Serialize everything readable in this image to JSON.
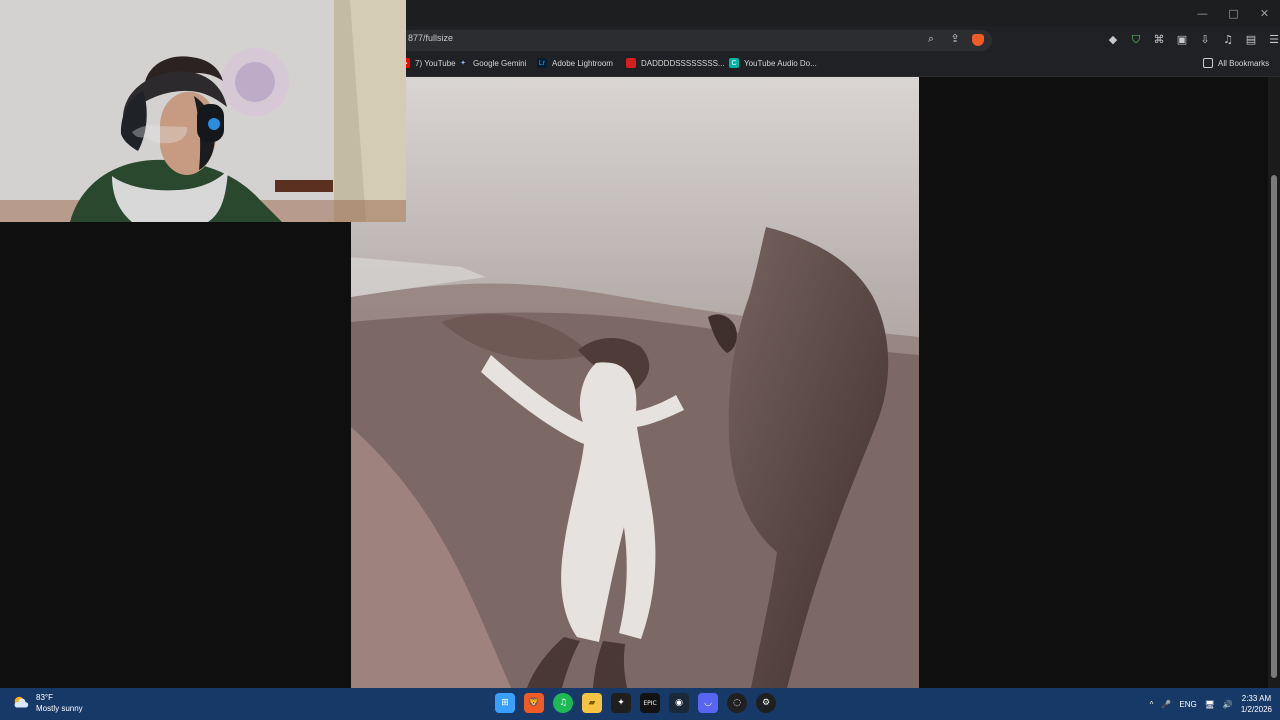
{
  "browser": {
    "address": "877/fullsize",
    "window_controls": [
      "—",
      "□",
      "✕"
    ],
    "url_actions": [
      "zoom-icon",
      "share-icon",
      "brave-shield-icon"
    ],
    "tool_icons": [
      "brave-ai-icon",
      "vpn-icon",
      "extensions-icon",
      "screenshot-icon",
      "download-icon",
      "music-icon",
      "sidebar-icon",
      "menu-icon"
    ]
  },
  "bookmarks": {
    "items": [
      {
        "label": "7) YouTube",
        "icon": "youtube-icon",
        "color": "#ff0000"
      },
      {
        "label": "Google Gemini",
        "icon": "gemini-icon",
        "color": "#8ab4f8"
      },
      {
        "label": "Adobe Lightroom",
        "icon": "lightroom-icon",
        "color": "#001e36"
      },
      {
        "label": "DADDDDSSSSSSSS...",
        "icon": "red-bookmark-icon",
        "color": "#d61e1e"
      },
      {
        "label": "YouTube Audio Do...",
        "icon": "audio-download-icon",
        "color": "#00b3a6"
      }
    ],
    "folder": "All Bookmarks"
  },
  "content": {
    "image_subject": "desert-gif-dancing-man-and-camel"
  },
  "taskbar": {
    "weather_temp": "83°F",
    "weather_desc": "Mostly sunny",
    "apps": [
      {
        "name": "windows-start-icon",
        "color": "#3aa0ff",
        "symbol": "⊞"
      },
      {
        "name": "brave-icon",
        "color": "#f05a24",
        "symbol": "🦁"
      },
      {
        "name": "spotify-icon",
        "color": "#1db954",
        "symbol": "♫"
      },
      {
        "name": "file-explorer-icon",
        "color": "#f6c343",
        "symbol": "▰"
      },
      {
        "name": "davinci-icon",
        "color": "#1f1f1f",
        "symbol": "✦"
      },
      {
        "name": "epic-icon",
        "color": "#121212",
        "symbol": "EPIC"
      },
      {
        "name": "steam-icon",
        "color": "#1b2838",
        "symbol": "◉"
      },
      {
        "name": "discord-icon",
        "color": "#5865f2",
        "symbol": "◡"
      },
      {
        "name": "obs-icon",
        "color": "#202020",
        "symbol": "◌"
      },
      {
        "name": "settings-icon",
        "color": "#1f1f1f",
        "symbol": "⚙"
      }
    ],
    "tray": {
      "chevron": "^",
      "mic": "🎤",
      "lang": "ENG",
      "network": "🖥",
      "volume": "🔊",
      "time": "2:33 AM",
      "date": "1/2/2026"
    }
  }
}
